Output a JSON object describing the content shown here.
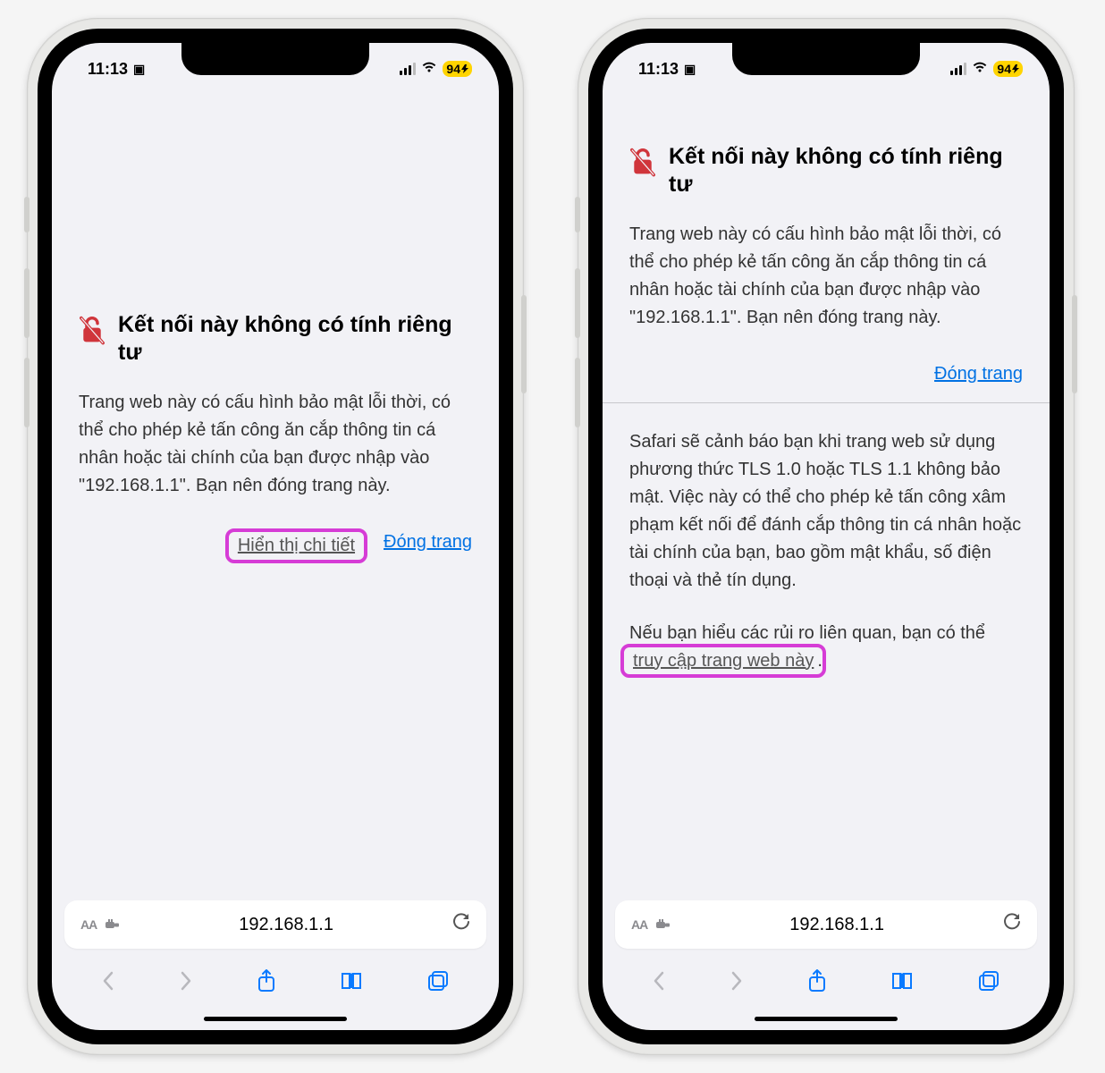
{
  "status": {
    "time": "11:13",
    "battery": "94"
  },
  "phone1": {
    "title": "Kết nối này không có tính riêng tư",
    "body": "Trang web này có cấu hình bảo mật lỗi thời, có thể cho phép kẻ tấn công ăn cắp thông tin cá nhân hoặc tài chính của bạn được nhập vào \"192.168.1.1\". Bạn nên đóng trang này.",
    "show_details": "Hiển thị chi tiết",
    "close": "Đóng trang"
  },
  "phone2": {
    "title": "Kết nối này không có tính riêng tư",
    "body": "Trang web này có cấu hình bảo mật lỗi thời, có thể cho phép kẻ tấn công ăn cắp thông tin cá nhân hoặc tài chính của bạn được nhập vào \"192.168.1.1\". Bạn nên đóng trang này.",
    "close": "Đóng trang",
    "detail": "Safari sẽ cảnh báo bạn khi trang web sử dụng phương thức TLS 1.0 hoặc TLS 1.1 không bảo mật. Việc này có thể cho phép kẻ tấn công xâm phạm kết nối để đánh cắp thông tin cá nhân hoặc tài chính của bạn, bao gồm mật khẩu, số điện thoại và thẻ tín dụng.",
    "visit_pre": "Nếu bạn hiểu các rủi ro liên quan, bạn có thể ",
    "visit_link": "truy cập trang web này",
    "visit_post": "."
  },
  "addrbar": {
    "aa": "AA",
    "url": "192.168.1.1"
  }
}
